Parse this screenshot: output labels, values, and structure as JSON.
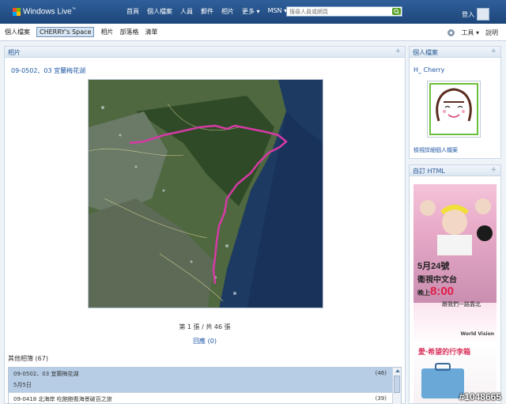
{
  "header": {
    "brand": "Windows Live",
    "brand_mark": "™",
    "nav": [
      "首頁",
      "個人檔案",
      "人員",
      "郵件",
      "相片",
      "更多 ▾",
      "MSN ▾"
    ],
    "search_placeholder": "搜尋人員或網頁",
    "signin": "登入"
  },
  "subnav": {
    "items": [
      "個人檔案",
      "CHERRY's Space",
      "相片",
      "部落格",
      "清單"
    ],
    "active_index": 1,
    "tools": "工具 ▾",
    "help": "說明"
  },
  "photos_panel": {
    "title": "相片",
    "plus": "+",
    "album_title": "09-0502、03 宜蘭梅花湖",
    "counter": "第 1 張 / 共 46 張",
    "comments": "回應 (0)",
    "other_albums_label": "其他相簿 (67)",
    "albums": [
      {
        "name": "09-0502、03 宜蘭梅花湖",
        "count": "(46)",
        "date": "5月5日",
        "selected": true
      },
      {
        "name": "09-0418 北海岸 吃飽飽看海景破百之旅",
        "count": "(39)",
        "date": "",
        "selected": false
      }
    ]
  },
  "profile_panel": {
    "title": "個人檔案",
    "plus": "+",
    "name": "H_ Cherry",
    "link": "檢視詳細個人檔案"
  },
  "html_panel": {
    "title": "自訂 HTML",
    "plus": "+",
    "ad_date": "5月24號",
    "ad_channel": "衛視中文台",
    "ad_time_prefix": "晚上",
    "ad_time": "8:00",
    "ad_sub": "跟我們一路靠北",
    "ad_brand": "World Vision",
    "ad_love": "愛‧希望的行李箱"
  },
  "watermark": "#1048665",
  "colors": {
    "accent": "#1f57a4",
    "topbar": "#2f5f9a",
    "route": "#d63aa6"
  }
}
